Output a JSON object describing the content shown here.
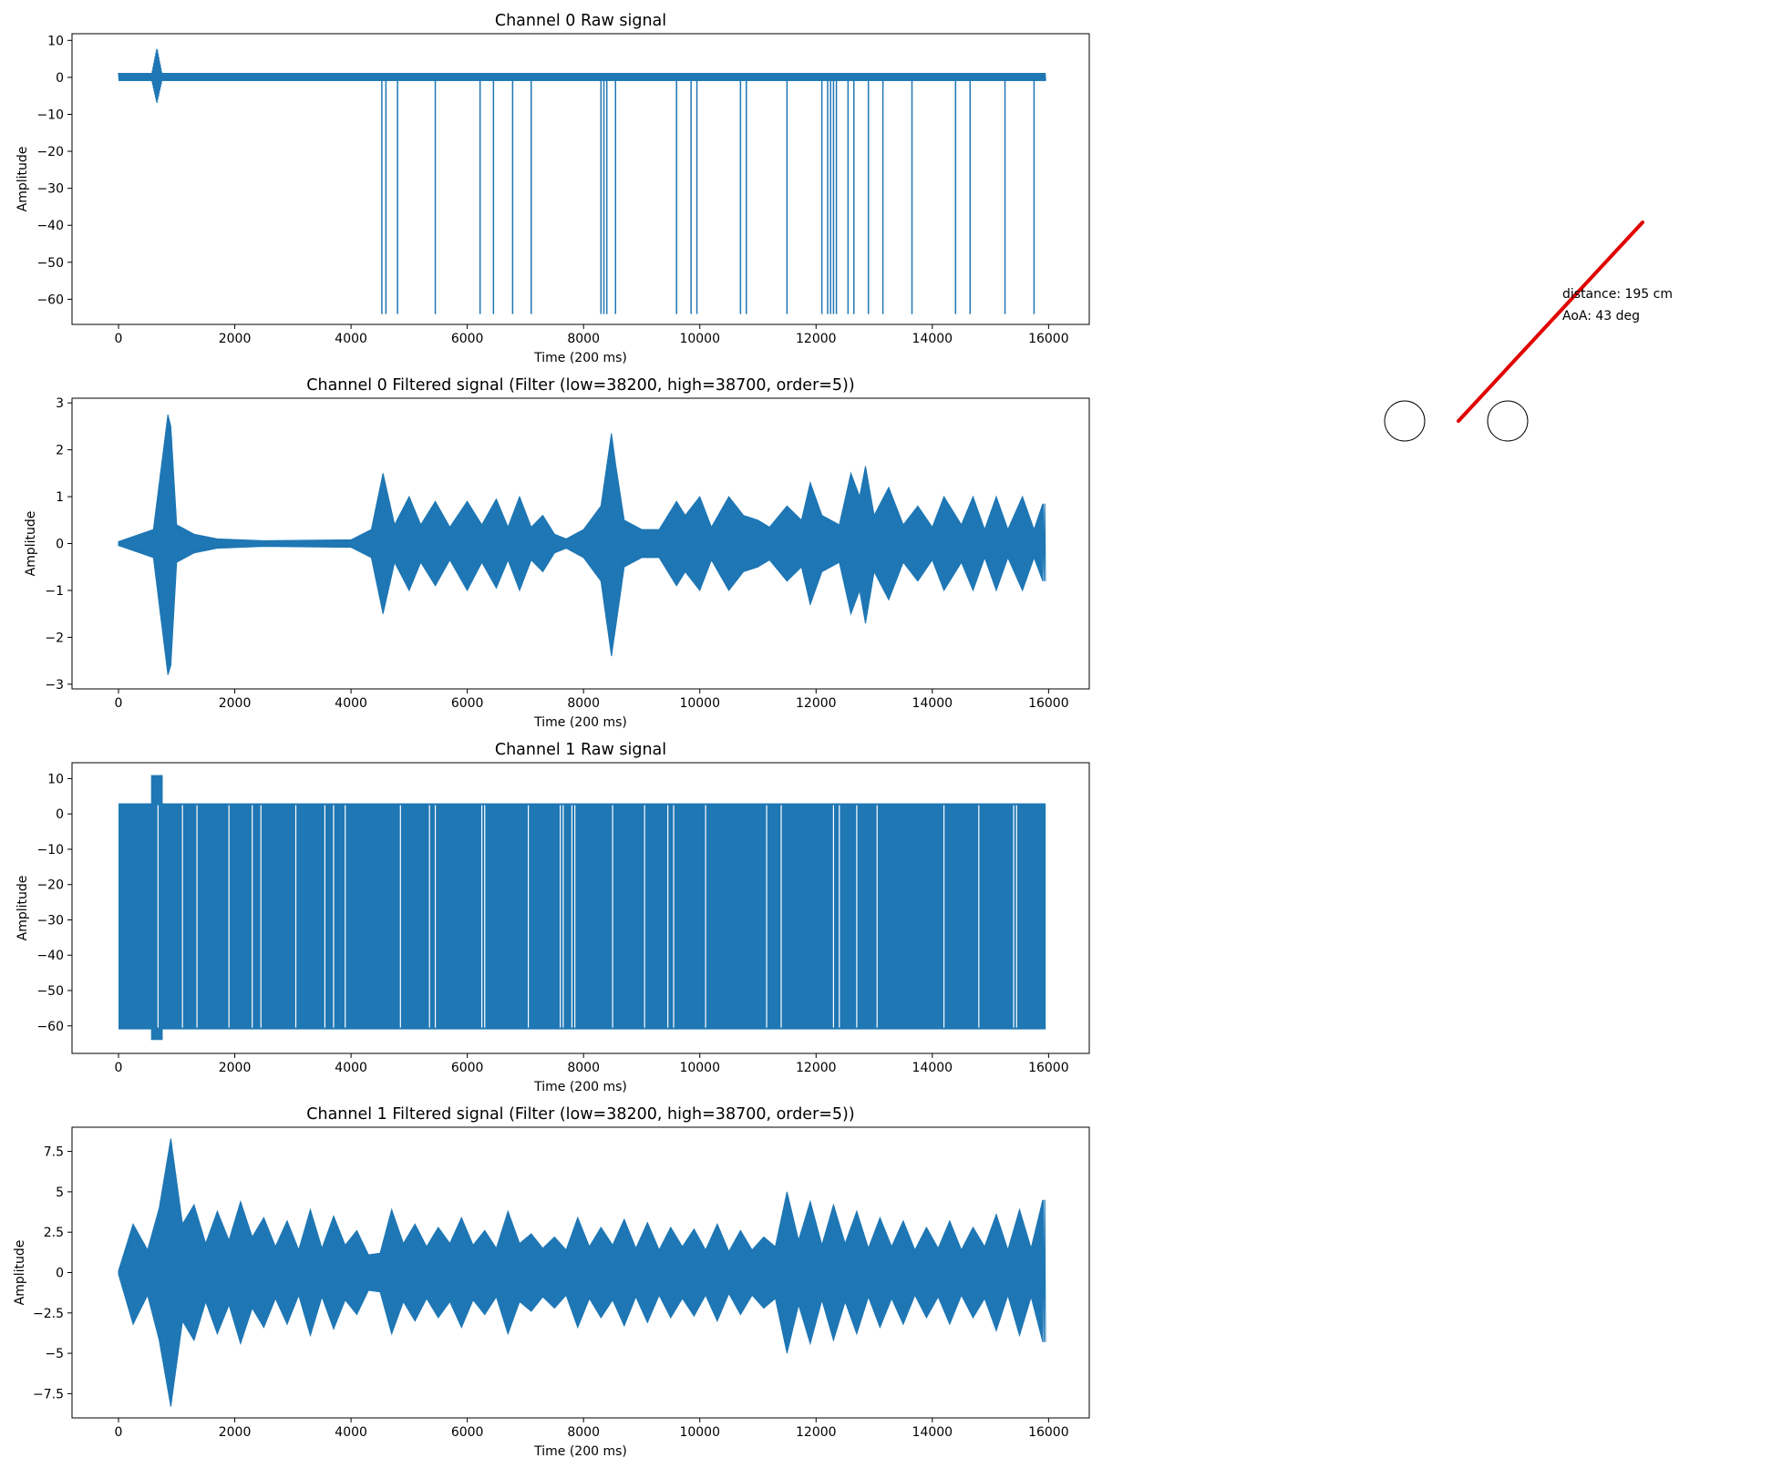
{
  "chart_data": [
    {
      "type": "line",
      "title": "Channel 0 Raw signal",
      "xlabel": "Time (200 ms)",
      "ylabel": "Amplitude",
      "xlim": [
        -800,
        16700
      ],
      "ylim": [
        -66.8,
        11.8
      ],
      "xticks": [
        0,
        2000,
        4000,
        6000,
        8000,
        10000,
        12000,
        14000,
        16000
      ],
      "yticks": [
        10,
        0,
        -10,
        -20,
        -30,
        -40,
        -50,
        -60
      ],
      "series": [
        {
          "color": "#1f77b4",
          "baseline": [
            -1,
            1.2
          ],
          "burst": {
            "x": [
              560,
              760
            ],
            "min": -7,
            "max": 8
          },
          "spikes_to": -64,
          "spike_x": [
            4530,
            4600,
            4800,
            5450,
            6220,
            6450,
            6780,
            7100,
            8300,
            8350,
            8400,
            8550,
            9600,
            9850,
            9950,
            10700,
            10800,
            11500,
            12100,
            12200,
            12250,
            12300,
            12350,
            12550,
            12650,
            12900,
            13150,
            13650,
            14400,
            14650,
            15250,
            15750
          ]
        }
      ]
    },
    {
      "type": "line",
      "title": "Channel 0 Filtered signal (Filter (low=38200, high=38700, order=5))",
      "xlabel": "Time (200 ms)",
      "ylabel": "Amplitude",
      "xlim": [
        -800,
        16700
      ],
      "ylim": [
        -3.1,
        3.1
      ],
      "xticks": [
        0,
        2000,
        4000,
        6000,
        8000,
        10000,
        12000,
        14000,
        16000
      ],
      "yticks": [
        3,
        2,
        1,
        0,
        -1,
        -2,
        -3
      ],
      "series": [
        {
          "color": "#1f77b4",
          "envelope": {
            "x": [
              0,
              600,
              850,
              900,
              1000,
              1300,
              1700,
              2500,
              4000,
              4350,
              4550,
              4750,
              5000,
              5200,
              5450,
              5700,
              6000,
              6250,
              6500,
              6700,
              6900,
              7100,
              7300,
              7500,
              7700,
              8000,
              8300,
              8480,
              8550,
              8700,
              9000,
              9300,
              9600,
              9750,
              10000,
              10200,
              10500,
              10750,
              11000,
              11200,
              11500,
              11750,
              11900,
              12100,
              12400,
              12600,
              12750,
              12850,
              13000,
              13250,
              13500,
              13750,
              14000,
              14200,
              14500,
              14700,
              14900,
              15100,
              15300,
              15550,
              15750,
              15900
            ],
            "upper": [
              0.04,
              0.3,
              2.75,
              2.5,
              0.4,
              0.2,
              0.1,
              0.06,
              0.08,
              0.3,
              1.5,
              0.4,
              1.0,
              0.4,
              0.9,
              0.35,
              0.9,
              0.4,
              0.95,
              0.35,
              1.0,
              0.35,
              0.6,
              0.2,
              0.1,
              0.3,
              0.8,
              2.35,
              1.7,
              0.5,
              0.3,
              0.3,
              0.9,
              0.6,
              1.0,
              0.35,
              1.0,
              0.6,
              0.5,
              0.35,
              0.8,
              0.5,
              1.3,
              0.6,
              0.4,
              1.5,
              1.0,
              1.65,
              0.6,
              1.2,
              0.4,
              0.8,
              0.35,
              1.0,
              0.4,
              1.0,
              0.3,
              1.0,
              0.3,
              1.0,
              0.3,
              0.85
            ],
            "lower": [
              -0.04,
              -0.3,
              -2.8,
              -2.6,
              -0.4,
              -0.2,
              -0.1,
              -0.06,
              -0.08,
              -0.3,
              -1.5,
              -0.4,
              -1.0,
              -0.4,
              -0.9,
              -0.35,
              -1.0,
              -0.4,
              -0.95,
              -0.35,
              -1.0,
              -0.35,
              -0.6,
              -0.2,
              -0.1,
              -0.3,
              -0.8,
              -2.4,
              -1.8,
              -0.5,
              -0.3,
              -0.3,
              -0.9,
              -0.6,
              -1.0,
              -0.35,
              -1.0,
              -0.6,
              -0.5,
              -0.35,
              -0.8,
              -0.5,
              -1.3,
              -0.6,
              -0.4,
              -1.5,
              -1.0,
              -1.7,
              -0.6,
              -1.2,
              -0.4,
              -0.8,
              -0.35,
              -1.0,
              -0.4,
              -1.0,
              -0.3,
              -1.0,
              -0.3,
              -1.0,
              -0.3,
              -0.8
            ]
          }
        }
      ]
    },
    {
      "type": "line",
      "title": "Channel 1 Raw signal",
      "xlabel": "Time (200 ms)",
      "ylabel": "Amplitude",
      "xlim": [
        -800,
        16700
      ],
      "ylim": [
        -67.8,
        14.5
      ],
      "xticks": [
        0,
        2000,
        4000,
        6000,
        8000,
        10000,
        12000,
        14000,
        16000
      ],
      "yticks": [
        10,
        0,
        -10,
        -20,
        -30,
        -40,
        -50,
        -60
      ],
      "series": [
        {
          "color": "#1f77b4",
          "band": [
            -61,
            3
          ],
          "burst": {
            "x": [
              560,
              760
            ],
            "min": -64,
            "max": 11
          },
          "gap_x": [
            680,
            1100,
            1350,
            1900,
            2300,
            2450,
            3050,
            3550,
            3700,
            3900,
            4850,
            5350,
            5450,
            6250,
            6300,
            7050,
            7600,
            7650,
            7800,
            7850,
            8500,
            9050,
            9450,
            9550,
            10100,
            11150,
            11400,
            12300,
            12400,
            12700,
            13050,
            14200,
            14800,
            15400,
            15450
          ]
        }
      ]
    },
    {
      "type": "line",
      "title": "Channel 1 Filtered signal (Filter (low=38200, high=38700, order=5))",
      "xlabel": "Time (200 ms)",
      "ylabel": "Amplitude",
      "xlim": [
        -800,
        16700
      ],
      "ylim": [
        -9.0,
        9.0
      ],
      "xticks": [
        0,
        2000,
        4000,
        6000,
        8000,
        10000,
        12000,
        14000,
        16000
      ],
      "yticks": [
        7.5,
        5.0,
        2.5,
        0.0,
        -2.5,
        -5.0,
        -7.5
      ],
      "series": [
        {
          "color": "#1f77b4",
          "envelope": {
            "x": [
              0,
              250,
              500,
              700,
              900,
              1100,
              1300,
              1500,
              1700,
              1900,
              2100,
              2300,
              2500,
              2700,
              2900,
              3100,
              3300,
              3500,
              3700,
              3900,
              4100,
              4300,
              4500,
              4700,
              4900,
              5100,
              5300,
              5500,
              5700,
              5900,
              6100,
              6300,
              6500,
              6700,
              6900,
              7100,
              7300,
              7500,
              7700,
              7900,
              8100,
              8300,
              8500,
              8700,
              8900,
              9100,
              9300,
              9500,
              9700,
              9900,
              10100,
              10300,
              10500,
              10700,
              10900,
              11100,
              11300,
              11500,
              11700,
              11900,
              12100,
              12300,
              12500,
              12700,
              12900,
              13100,
              13300,
              13500,
              13700,
              13900,
              14100,
              14300,
              14500,
              14700,
              14900,
              15100,
              15300,
              15500,
              15700,
              15900
            ],
            "upper": [
              0.1,
              3.0,
              1.4,
              4.0,
              8.3,
              3.0,
              4.2,
              1.8,
              3.8,
              2.0,
              4.4,
              2.2,
              3.4,
              1.6,
              3.2,
              1.4,
              3.9,
              1.5,
              3.5,
              1.7,
              2.6,
              1.1,
              1.2,
              3.9,
              1.8,
              3.0,
              1.6,
              2.8,
              1.8,
              3.4,
              1.7,
              2.6,
              1.5,
              3.8,
              1.8,
              2.4,
              1.5,
              2.2,
              1.4,
              3.4,
              1.6,
              2.8,
              1.7,
              3.3,
              1.5,
              3.1,
              1.4,
              2.8,
              1.6,
              2.7,
              1.4,
              3.0,
              1.3,
              2.6,
              1.4,
              2.2,
              1.6,
              5.0,
              2.0,
              4.4,
              1.7,
              4.2,
              1.8,
              3.8,
              1.5,
              3.4,
              1.6,
              3.2,
              1.4,
              2.8,
              1.5,
              3.2,
              1.4,
              2.8,
              1.6,
              3.6,
              1.4,
              3.9,
              1.5,
              4.5
            ],
            "lower": [
              -0.1,
              -3.2,
              -1.4,
              -4.2,
              -8.3,
              -3.0,
              -4.2,
              -1.8,
              -3.8,
              -2.0,
              -4.4,
              -2.2,
              -3.4,
              -1.6,
              -3.2,
              -1.4,
              -3.9,
              -1.5,
              -3.5,
              -1.7,
              -2.6,
              -1.1,
              -1.2,
              -3.8,
              -1.8,
              -3.0,
              -1.6,
              -2.8,
              -1.8,
              -3.4,
              -1.7,
              -2.6,
              -1.5,
              -3.8,
              -1.8,
              -2.4,
              -1.5,
              -2.2,
              -1.4,
              -3.4,
              -1.6,
              -2.8,
              -1.7,
              -3.3,
              -1.5,
              -3.1,
              -1.4,
              -2.8,
              -1.6,
              -2.7,
              -1.4,
              -3.0,
              -1.3,
              -2.6,
              -1.4,
              -2.2,
              -1.6,
              -5.0,
              -2.0,
              -4.4,
              -1.7,
              -4.2,
              -1.8,
              -3.8,
              -1.5,
              -3.4,
              -1.6,
              -3.2,
              -1.4,
              -2.8,
              -1.5,
              -3.2,
              -1.4,
              -2.8,
              -1.6,
              -3.6,
              -1.4,
              -3.9,
              -1.5,
              -4.3
            ]
          }
        }
      ]
    }
  ],
  "aoa_panel": {
    "distance_text": "distance: 195 cm",
    "aoa_text": "AoA: 43 deg",
    "arrow_color": "#e00000",
    "aoa_deg": 43
  }
}
